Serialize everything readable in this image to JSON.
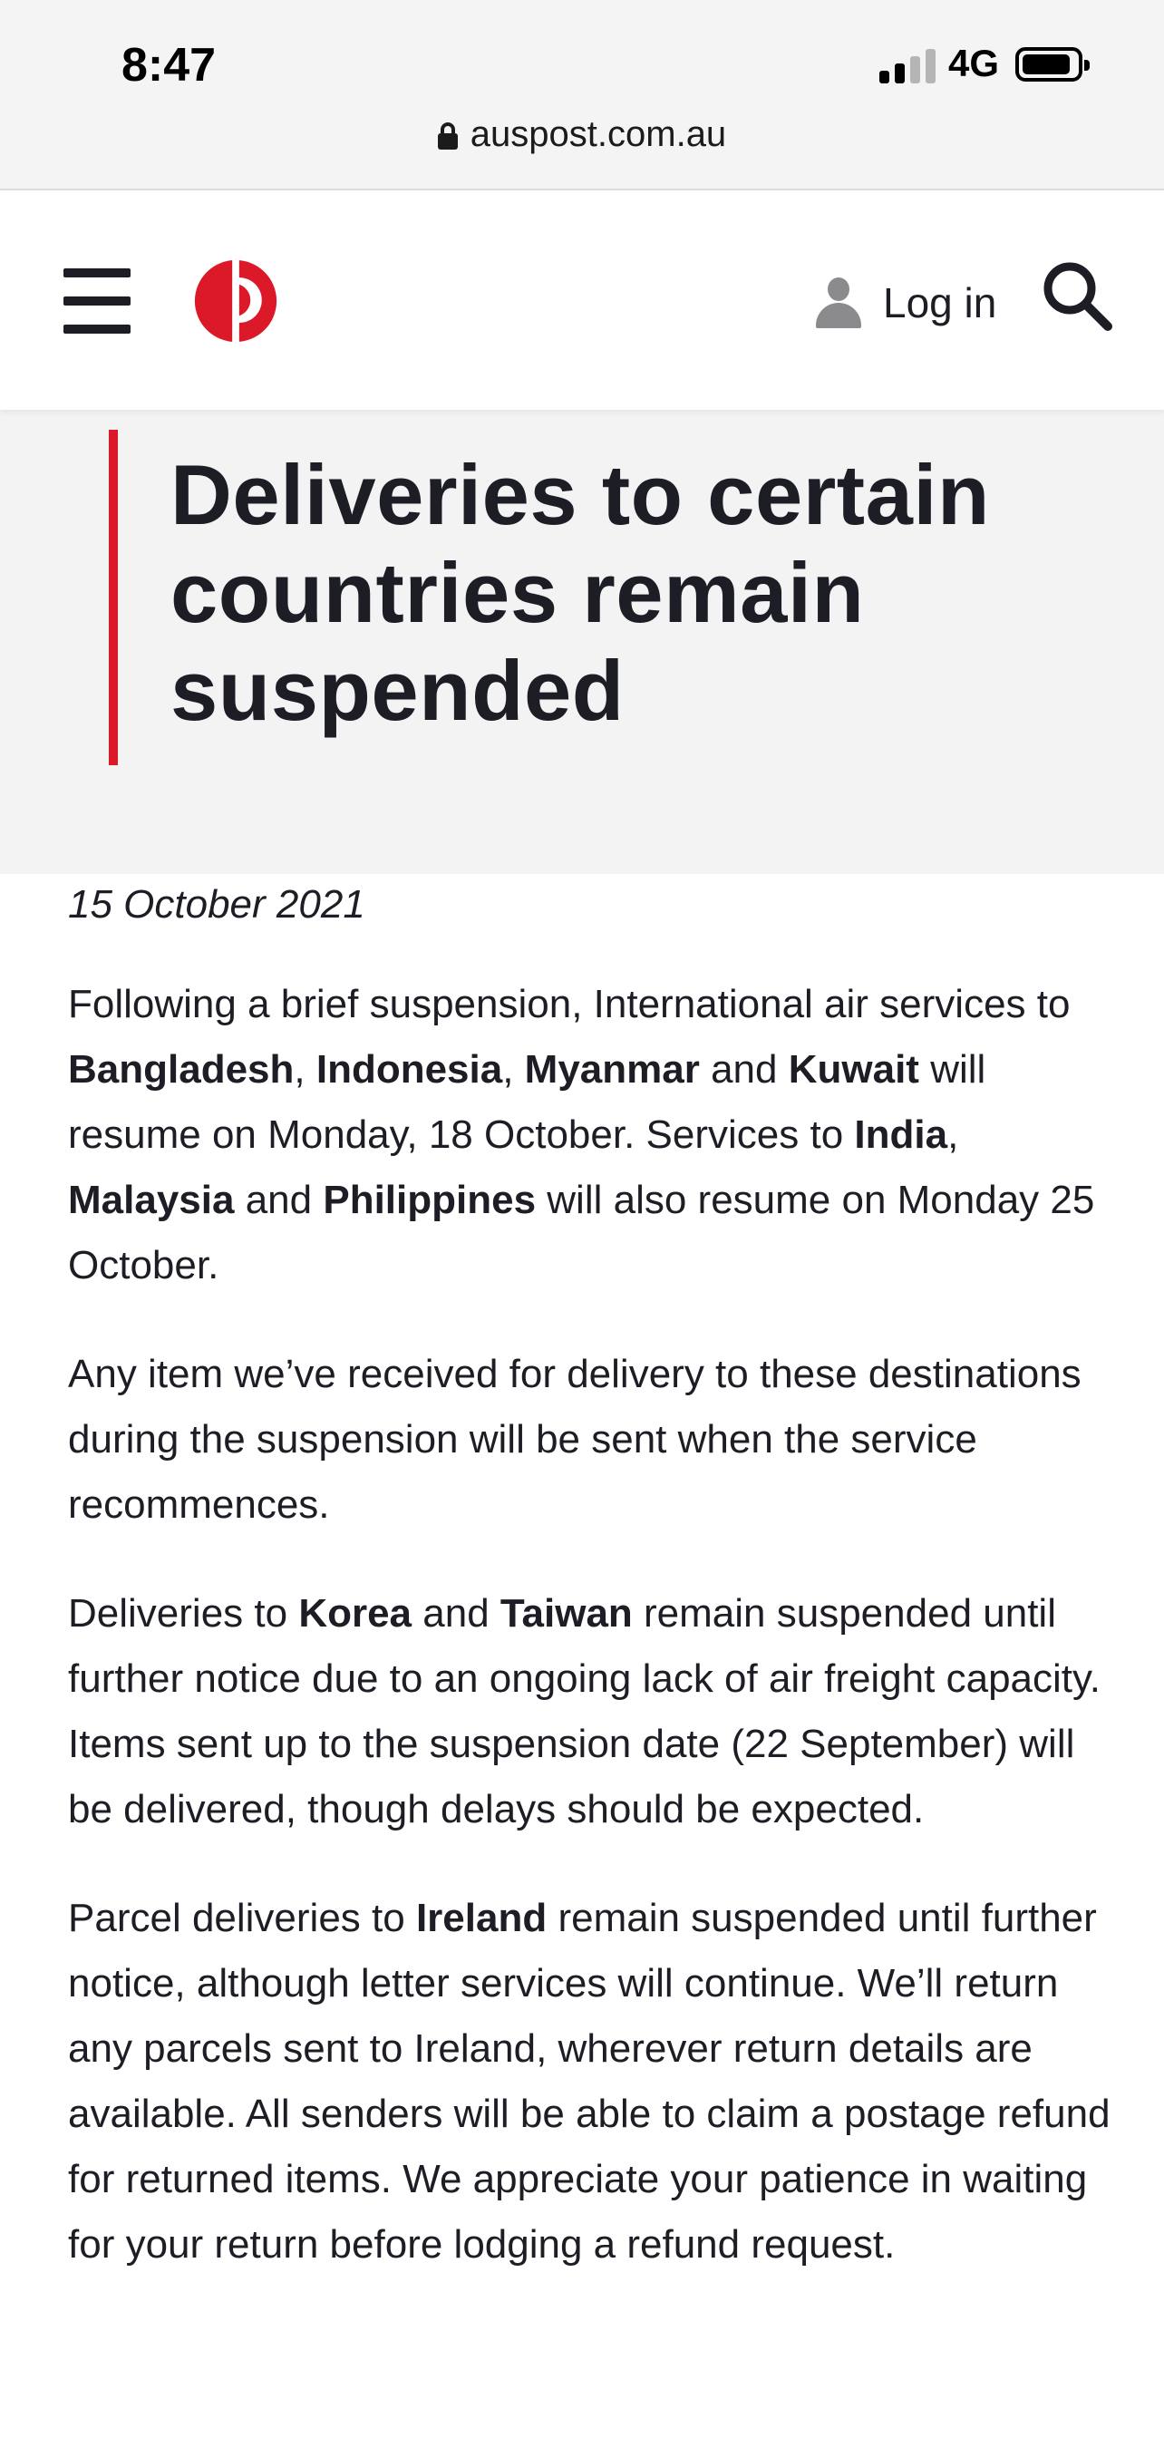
{
  "status_bar": {
    "time": "8:47",
    "network": "4G"
  },
  "browser": {
    "url": "auspost.com.au"
  },
  "header": {
    "menu_icon": "hamburger-menu-icon",
    "logo_icon": "australia-post-logo",
    "brand_color": "#dc1928",
    "login_label": "Log in",
    "user_icon": "user-icon",
    "search_icon": "search-icon"
  },
  "page": {
    "title": "Deliveries to certain countries remain suspended",
    "date": "15 October 2021"
  },
  "paragraphs": {
    "p1": {
      "t1": "Following a brief suspension, International air services to ",
      "b1": "Bangladesh",
      "t2": ", ",
      "b2": "Indonesia",
      "t3": ", ",
      "b3": "Myanmar",
      "t4": " and ",
      "b4": "Kuwait",
      "t5": " will resume on Monday, 18 October. Services to ",
      "b5": "India",
      "t6": ", ",
      "b6": "Malaysia",
      "t7": " and ",
      "b7": "Philippines",
      "t8": " will also resume on Monday 25 October."
    },
    "p2": {
      "t1": "Any item we’ve received for delivery to these destinations during the suspension will be sent when the service recommences."
    },
    "p3": {
      "t1": "Deliveries to ",
      "b1": "Korea",
      "t2": " and ",
      "b2": "Taiwan",
      "t3": " remain suspended until further notice due to an ongoing lack of air freight capacity. Items sent up to the suspension date (22 September) will be delivered, though delays should be expected."
    },
    "p4": {
      "t1": "Parcel deliveries to ",
      "b1": "Ireland",
      "t2": " remain suspended until further notice, although letter services will continue. We’ll return any parcels sent to Ireland, wherever return details are available. All senders will be able to claim a postage refund for returned items. We appreciate your patience in waiting for your return before lodging a refund request."
    }
  }
}
